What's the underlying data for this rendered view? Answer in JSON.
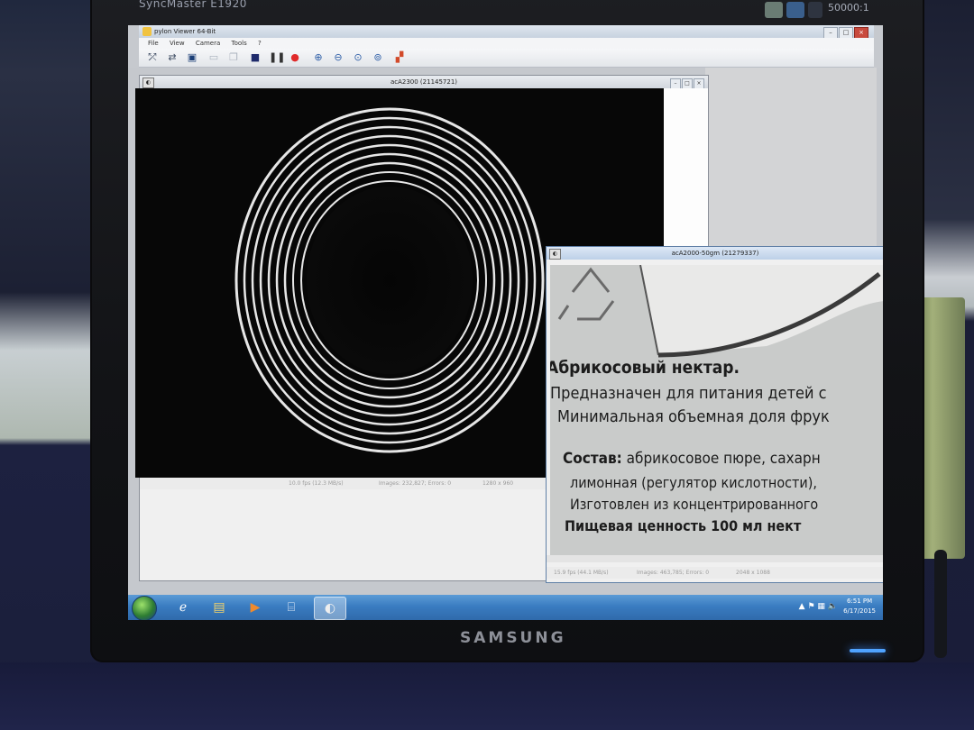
{
  "bezel": {
    "model": "SyncMaster E1920",
    "brand": "SAMSUNG",
    "contrast": "50000:1"
  },
  "app": {
    "title": "pylon Viewer 64-Bit",
    "menu": [
      "File",
      "View",
      "Camera",
      "Tools",
      "?"
    ],
    "toolbar_icons": [
      "disconnect-icon",
      "connect-icon",
      "save-icon",
      "window-icon",
      "tile-icon",
      "stop-icon",
      "pause-icon",
      "record-icon",
      "zoom-in-icon",
      "zoom-out-icon",
      "zoom-fit-icon",
      "zoom-100-icon",
      "color-icon"
    ]
  },
  "camera_window_1": {
    "title": "acA2300 (21145721)",
    "status": {
      "fps": "10.0 fps (12.3 MB/s)",
      "images": "Images: 232,827; Errors: 0",
      "resolution": "1280 x 960"
    }
  },
  "camera_window_2": {
    "title": "acA2000-50gm (21279337)",
    "status": {
      "fps": "15.9 fps (44.1 MB/s)",
      "images": "Images: 463,785; Errors: 0",
      "resolution": "2048 x 1088"
    },
    "packaging_text": {
      "line1": "Абрикосовый нектар.",
      "line2": "Предназначен для питания детей с",
      "line3": "Минимальная объемная доля фрук",
      "line4a": "Состав:",
      "line4b": " абрикосовое пюре, сахарн",
      "line5": "лимонная (регулятор кислотности),",
      "line6": "Изготовлен из концентрированного",
      "line7": "Пищевая ценность 100 мл нект"
    }
  },
  "taskbar": {
    "clock_time": "6:51 PM",
    "clock_date": "6/17/2015"
  },
  "colors": {
    "taskbar": "#3a7cc1",
    "record": "#e02a2a"
  }
}
